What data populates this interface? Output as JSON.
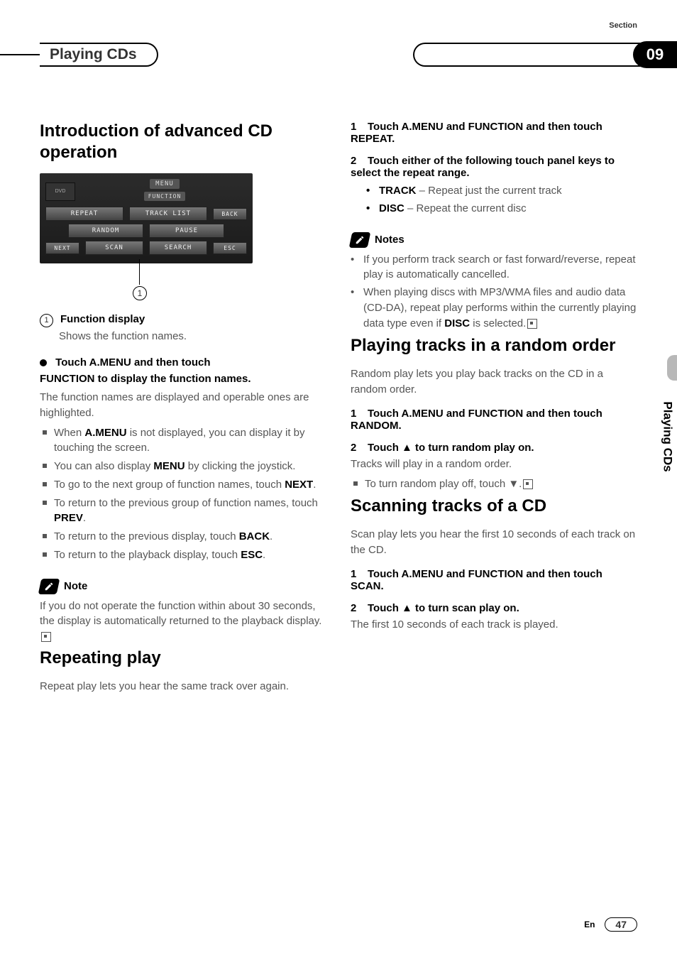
{
  "header": {
    "section_label": "Section",
    "title": "Playing CDs",
    "section_number": "09",
    "side_tab": "Playing CDs"
  },
  "left": {
    "h_intro": "Introduction of advanced CD operation",
    "screen": {
      "menu": "MENU",
      "function": "FUNCTION",
      "repeat": "REPEAT",
      "tracklist": "TRACK LIST",
      "back": "BACK",
      "random": "RANDOM",
      "pause": "PAUSE",
      "next": "NEXT",
      "scan": "SCAN",
      "search": "SEARCH",
      "esc": "ESC",
      "dvd": "DVD"
    },
    "callout_num": "1",
    "def_num": "1",
    "def_label": "Function display",
    "def_desc": "Shows the function names.",
    "lead_line1": "Touch A.MENU and then touch",
    "lead_line2": "FUNCTION to display the function names.",
    "lead_body": "The function names are displayed and operable ones are highlighted.",
    "bullets": {
      "b1a": "When ",
      "b1b": "A.MENU",
      "b1c": " is not displayed, you can display it by touching the screen.",
      "b2a": "You can also display ",
      "b2b": "MENU",
      "b2c": " by clicking the joystick.",
      "b3a": "To go to the next group of function names, touch ",
      "b3b": "NEXT",
      "b3c": ".",
      "b4a": "To return to the previous group of function names, touch ",
      "b4b": "PREV",
      "b4c": ".",
      "b5a": "To return to the previous display, touch ",
      "b5b": "BACK",
      "b5c": ".",
      "b6a": "To return to the playback display, touch ",
      "b6b": "ESC",
      "b6c": "."
    },
    "note_label": "Note",
    "note_body_a": "If you do not operate the function within about 30 seconds, the display is automatically returned to the playback display.",
    "h_repeat": "Repeating play",
    "repeat_body": "Repeat play lets you hear the same track over again."
  },
  "right": {
    "step1_num": "1",
    "step1_text": "Touch A.MENU and FUNCTION and then touch REPEAT.",
    "step2_num": "2",
    "step2_text": "Touch either of the following touch panel keys to select the repeat range.",
    "opt_track_label": "TRACK",
    "opt_track_desc": " – Repeat just the current track",
    "opt_disc_label": "DISC",
    "opt_disc_desc": " – Repeat the current disc",
    "notes_label": "Notes",
    "note_items": {
      "n1": "If you perform track search or fast forward/reverse, repeat play is automatically cancelled.",
      "n2a": "When playing discs with MP3/WMA files and audio data (CD-DA), repeat play performs within the currently playing data type even if ",
      "n2b": "DISC",
      "n2c": " is selected."
    },
    "h_random": "Playing tracks in a random order",
    "random_body": "Random play lets you play back tracks on the CD in a random order.",
    "rstep1_num": "1",
    "rstep1_text": "Touch A.MENU and FUNCTION and then touch RANDOM.",
    "rstep2_num": "2",
    "rstep2_text": "Touch ▲ to turn random play on.",
    "rstep2_body": "Tracks will play in a random order.",
    "r_bullet": "To turn random play off, touch ▼.",
    "h_scan": "Scanning tracks of a CD",
    "scan_body": "Scan play lets you hear the first 10 seconds of each track on the CD.",
    "sstep1_num": "1",
    "sstep1_text": "Touch A.MENU and FUNCTION and then touch SCAN.",
    "sstep2_num": "2",
    "sstep2_text": "Touch ▲ to turn scan play on.",
    "sstep2_body": "The first 10 seconds of each track is played."
  },
  "footer": {
    "lang": "En",
    "page": "47"
  }
}
